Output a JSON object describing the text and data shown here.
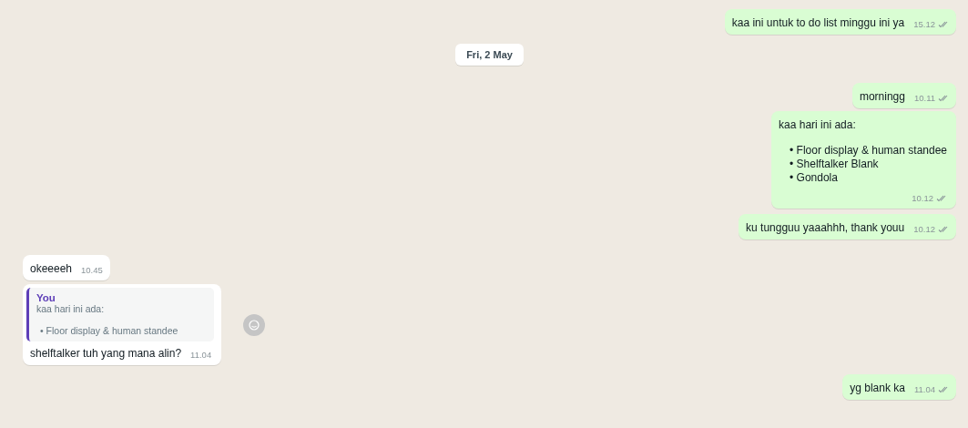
{
  "messages": [
    {
      "kind": "text",
      "outgoing": true,
      "text": "kaa ini untuk to do list minggu ini ya",
      "time": "15.12",
      "read": true
    },
    {
      "kind": "date",
      "text": "Fri, 2 May"
    },
    {
      "kind": "text",
      "outgoing": true,
      "text": "morningg",
      "time": "10.11",
      "read": true
    },
    {
      "kind": "list",
      "outgoing": true,
      "text": "kaa hari ini ada:",
      "items": [
        "• Floor display & human standee",
        "• Shelftalker Blank",
        "• Gondola"
      ],
      "time": "10.12",
      "read": true
    },
    {
      "kind": "text",
      "outgoing": true,
      "text": "ku tungguu yaaahhh, thank youu",
      "time": "10.12",
      "read": true
    },
    {
      "kind": "text",
      "outgoing": false,
      "text": "okeeeeh",
      "time": "10.45"
    },
    {
      "kind": "reply",
      "outgoing": false,
      "quote_author": "You",
      "quote_text": "kaa hari ini ada:",
      "quote_items": [
        "• Floor display & human standee"
      ],
      "text": "shelftalker tuh yang mana alin?",
      "time": "11.04"
    },
    {
      "kind": "text",
      "outgoing": true,
      "text": "yg blank ka",
      "time": "11.04",
      "read": true
    }
  ]
}
